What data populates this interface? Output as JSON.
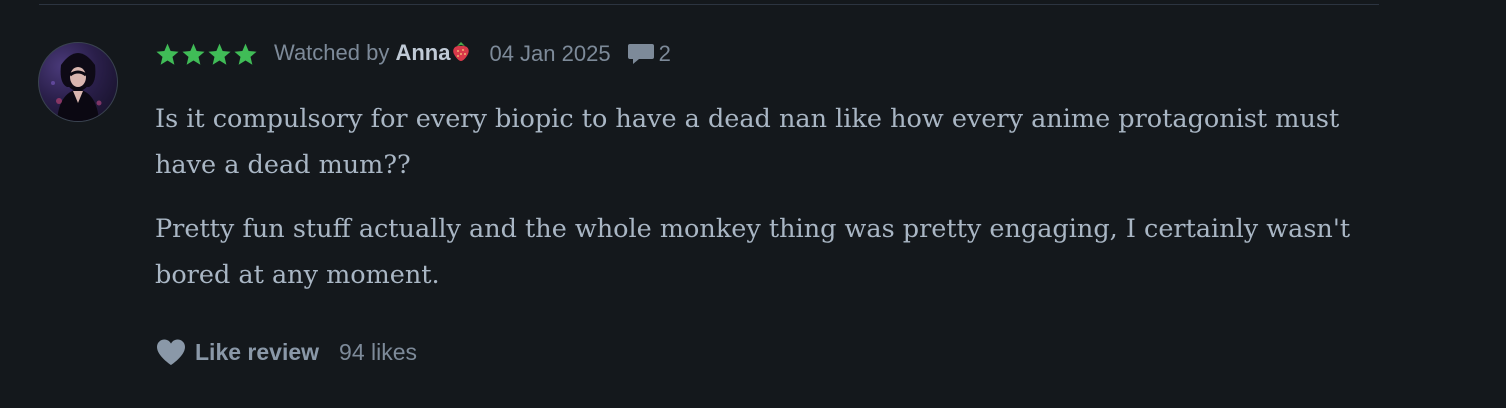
{
  "review": {
    "rating_stars": 4,
    "star_color": "#40bc57",
    "watched_prefix": "Watched by ",
    "username": "Anna",
    "username_icon": "strawberry-icon",
    "date": "04 Jan 2025",
    "comments_icon": "speech-bubble-icon",
    "comment_count": "2",
    "paragraphs": [
      "Is it compulsory for every biopic to have a dead nan like how every anime protagonist must have a dead mum??",
      "Pretty fun stuff actually and the whole monkey thing was pretty engaging, I certainly wasn't bored at any moment."
    ],
    "like_icon": "heart-icon",
    "like_label": "Like review",
    "likes_text": "94 likes"
  },
  "colors": {
    "background": "#14181c",
    "star": "#40bc57",
    "meta_text": "#7d8a99",
    "username": "#c0cad6",
    "body_text": "#a9b6c4"
  }
}
